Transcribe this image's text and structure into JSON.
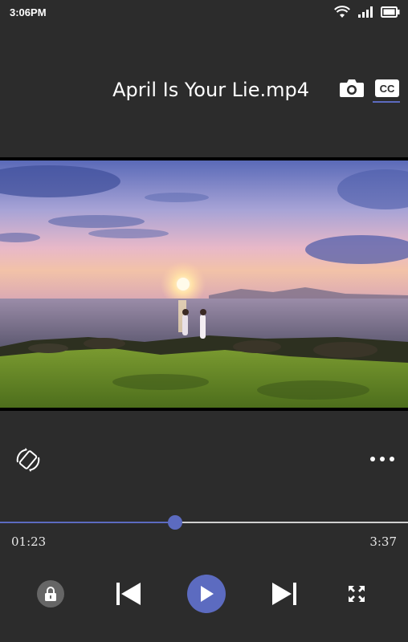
{
  "status_bar": {
    "time": "3:06PM"
  },
  "header": {
    "title": "April Is Your Lie.mp4",
    "cc_label": "CC"
  },
  "video": {
    "description_icon": "video-frame"
  },
  "playback": {
    "current_time": "01:23",
    "total_time": "3:37",
    "progress": 0.43
  },
  "icons": {
    "wifi": "wifi-icon",
    "signal": "signal-icon",
    "battery": "battery-icon",
    "camera": "camera-icon",
    "cc": "cc-icon",
    "rotate": "rotate-icon",
    "more": "more-icon",
    "lock": "lock-icon",
    "prev": "skip-previous-icon",
    "play": "play-icon",
    "next": "skip-next-icon",
    "fullscreen": "fullscreen-icon"
  },
  "colors": {
    "accent": "#5c6bc0",
    "background": "#2c2c2c"
  }
}
